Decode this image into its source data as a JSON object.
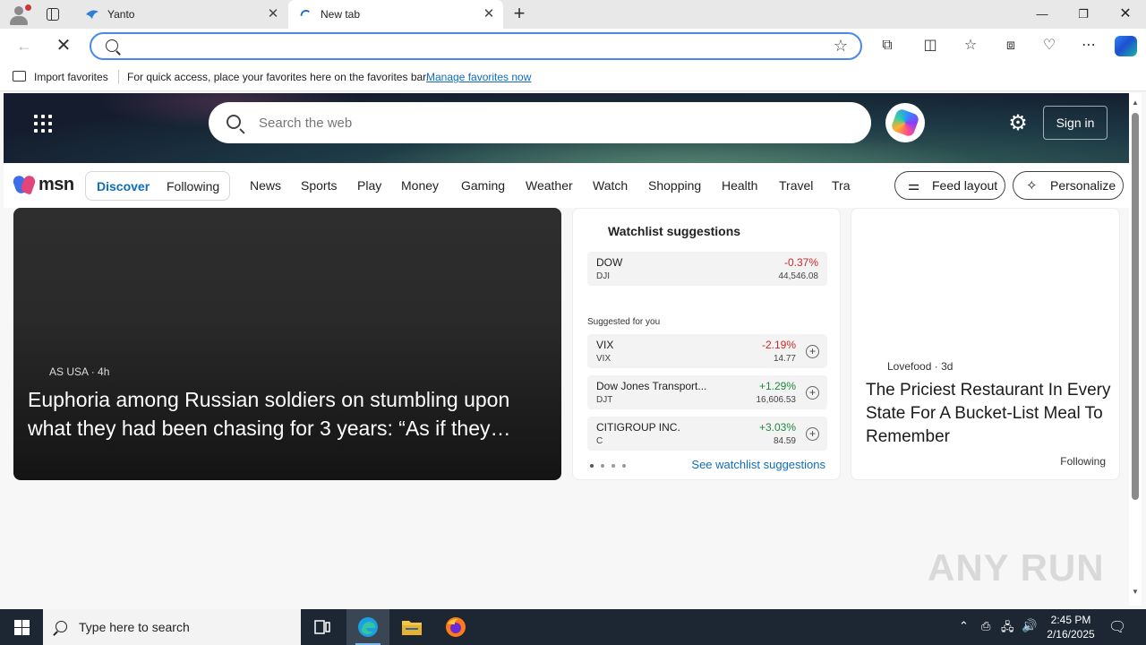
{
  "browser": {
    "tabs": [
      {
        "title": "Yanto"
      },
      {
        "title": "New tab"
      }
    ],
    "address": {
      "value": "",
      "placeholder": ""
    },
    "favorites_bar": {
      "import_label": "Import favorites",
      "hint": "For quick access, place your favorites here on the favorites bar.",
      "manage_link": "Manage favorites now"
    }
  },
  "msn": {
    "search_placeholder": "Search the web",
    "sign_in": "Sign in",
    "logo_text": "msn",
    "feed_tabs": [
      "Discover",
      "Following"
    ],
    "nav": [
      "News",
      "Sports",
      "Play",
      "Money",
      "Gaming",
      "Weather",
      "Watch",
      "Shopping",
      "Health",
      "Travel",
      "Tra"
    ],
    "feed_layout": "Feed layout",
    "personalize": "Personalize",
    "main_story": {
      "source": "AS USA",
      "age": "4h",
      "headline": "Euphoria among Russian soldiers on stumbling upon what they had been chasing for 3 years: “As if they…"
    },
    "watchlist": {
      "title": "Watchlist suggestions",
      "primary": {
        "name": "DOW",
        "symbol": "DJI",
        "change": "-0.37%",
        "value": "44,546.08"
      },
      "suggested_label": "Suggested for you",
      "suggestions": [
        {
          "name": "VIX",
          "symbol": "VIX",
          "change": "-2.19%",
          "value": "14.77"
        },
        {
          "name": "Dow Jones Transport...",
          "symbol": "DJT",
          "change": "+1.29%",
          "value": "16,606.53"
        },
        {
          "name": "CITIGROUP INC.",
          "symbol": "C",
          "change": "+3.03%",
          "value": "84.59"
        }
      ],
      "see_all": "See watchlist suggestions"
    },
    "side_story": {
      "source": "Lovefood",
      "age": "3d",
      "headline": "The Priciest Restaurant In Every State For A Bucket-List Meal To Remember",
      "following": "Following"
    }
  },
  "watermark": "ANY RUN",
  "taskbar": {
    "search_placeholder": "Type here to search",
    "time": "2:45 PM",
    "date": "2/16/2025"
  }
}
